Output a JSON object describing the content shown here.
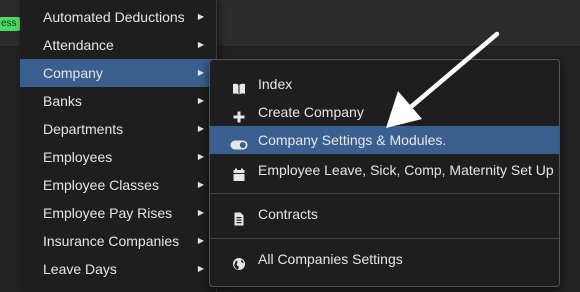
{
  "topbar": {
    "badge_text": "ess"
  },
  "menu": {
    "items": [
      {
        "label": "Automated Deductions"
      },
      {
        "label": "Attendance"
      },
      {
        "label": "Company"
      },
      {
        "label": "Banks"
      },
      {
        "label": "Departments"
      },
      {
        "label": "Employees"
      },
      {
        "label": "Employee Classes"
      },
      {
        "label": "Employee Pay Rises"
      },
      {
        "label": "Insurance Companies"
      },
      {
        "label": "Leave Days"
      }
    ],
    "active_item": "Company"
  },
  "submenu": {
    "items": [
      {
        "label": "Index",
        "icon": "book-icon"
      },
      {
        "label": "Create Company",
        "icon": "plus-icon"
      },
      {
        "label": "Company Settings & Modules.",
        "icon": "toggle-icon"
      },
      {
        "label": "Employee Leave, Sick, Comp, Maternity Set Up",
        "icon": "calendar-icon"
      },
      {
        "label": "Contracts",
        "icon": "document-icon"
      },
      {
        "label": "All Companies Settings",
        "icon": "globe-icon"
      }
    ],
    "highlighted_item": "Company Settings & Modules."
  },
  "colors": {
    "background": "#222222",
    "menu_background": "#1e1e1e",
    "highlight": "#3a5f8f",
    "badge": "#4cd964",
    "text": "#e6e6e6",
    "annotation_arrow": "#ffffff"
  }
}
